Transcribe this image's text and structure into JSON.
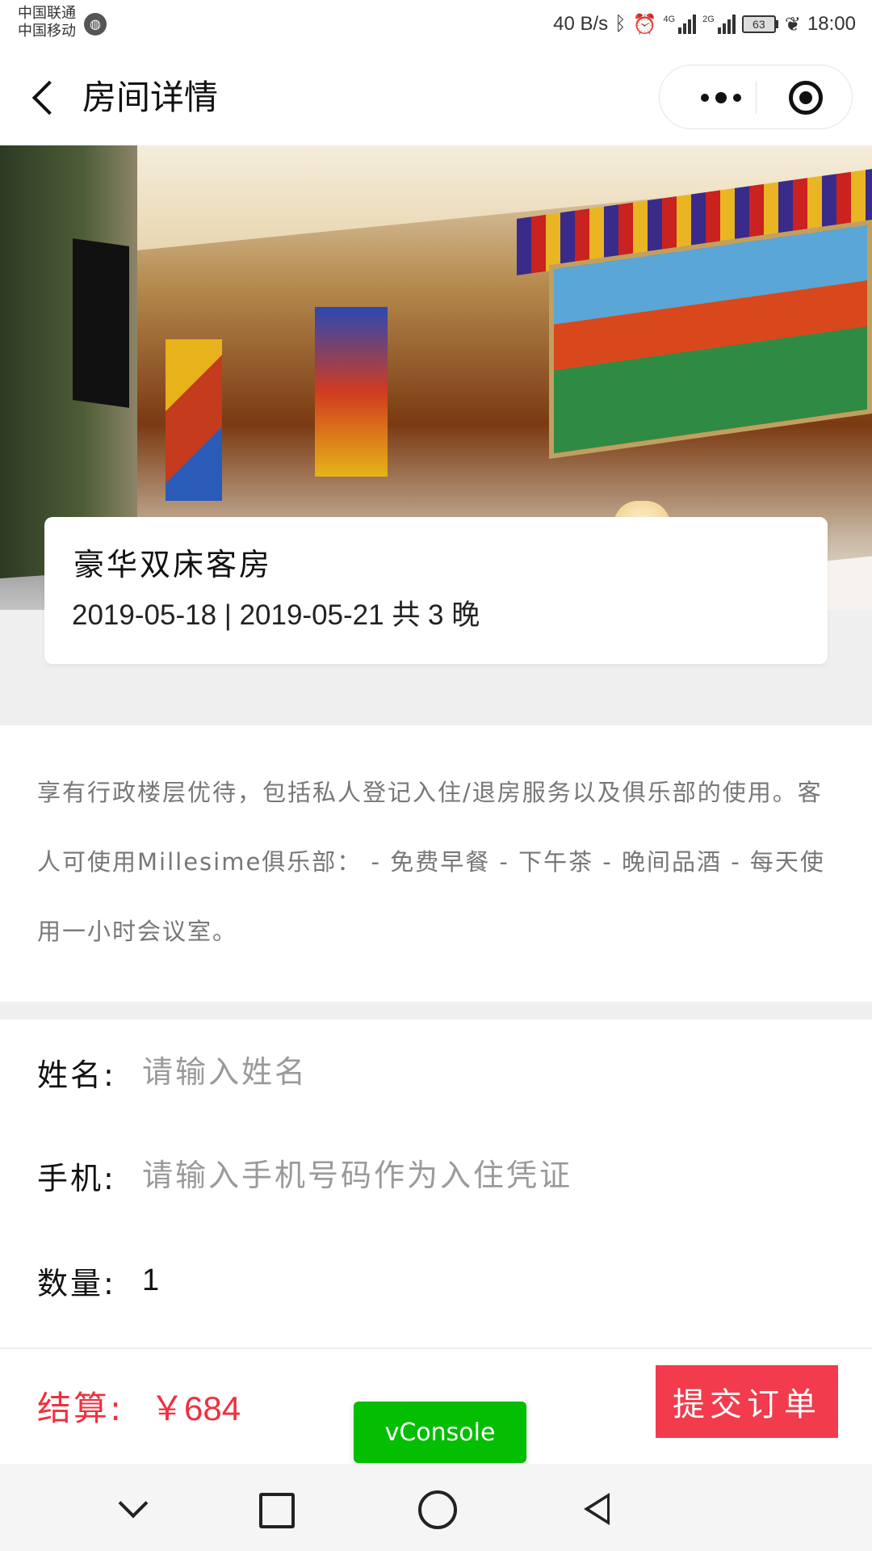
{
  "status_bar": {
    "carrier_1": "中国联通",
    "carrier_2": "中国移动",
    "net_speed": "40 B/s",
    "signal_1_tag": "4G",
    "signal_2_tag": "2G",
    "battery": "63",
    "time": "18:00"
  },
  "header": {
    "title": "房间详情"
  },
  "room": {
    "name": "豪华双床客房",
    "dates": "2019-05-18 | 2019-05-21 共 3 晚",
    "description": "享有行政楼层优待，包括私人登记入住/退房服务以及俱乐部的使用。客人可使用Millesime俱乐部： - 免费早餐 - 下午茶 - 晚间品酒 - 每天使用一小时会议室。"
  },
  "form": {
    "name_label": "姓名:",
    "name_placeholder": "请输入姓名",
    "phone_label": "手机:",
    "phone_placeholder": "请输入手机号码作为入住凭证",
    "quantity_label": "数量:",
    "quantity_value": "1"
  },
  "order": {
    "total_label": "结算:",
    "total_value": "￥684",
    "submit_label": "提交订单"
  },
  "debug": {
    "vconsole_label": "vConsole"
  },
  "colors": {
    "accent_red": "#f23b4c",
    "price_red": "#f0303f",
    "vconsole_green": "#04be02"
  },
  "icons": [
    "globe-icon",
    "bluetooth-icon",
    "alarm-icon",
    "signal-icon",
    "battery-icon",
    "leaf-icon",
    "back-arrow-icon",
    "more-icon",
    "target-icon",
    "nav-down-icon",
    "nav-recents-icon",
    "nav-home-icon",
    "nav-back-icon"
  ]
}
